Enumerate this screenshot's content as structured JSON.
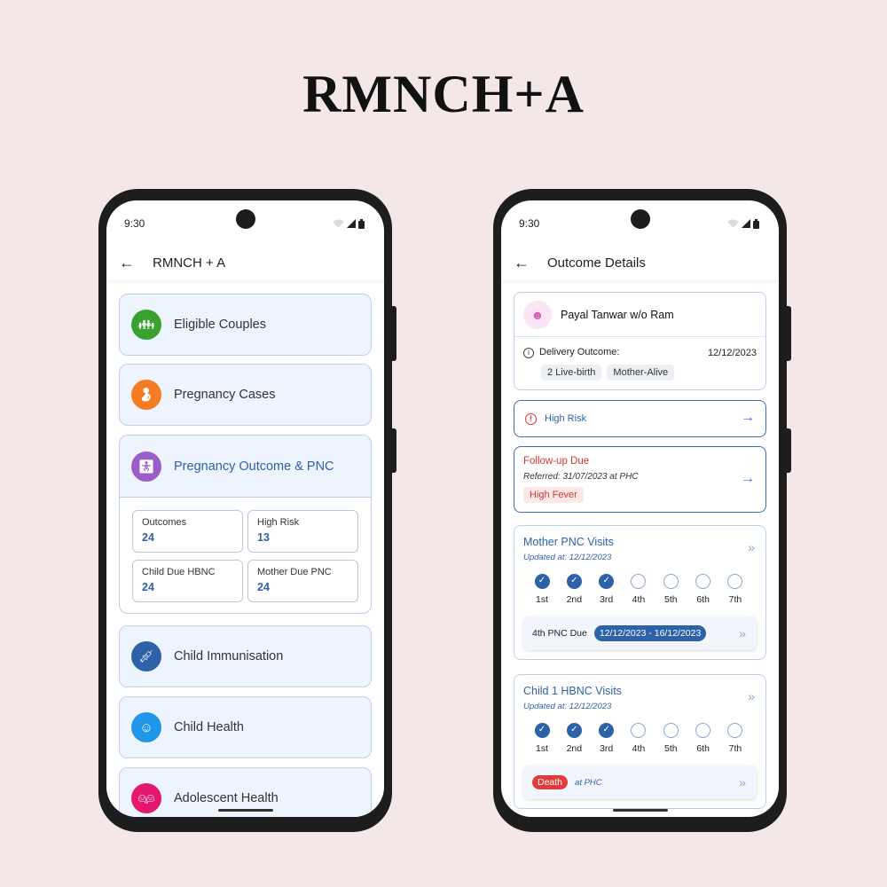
{
  "title": "RMNCH+A",
  "status_time": "9:30",
  "left": {
    "app_title": "RMNCH + A",
    "menu": [
      {
        "label": "Eligible Couples",
        "color": "#3aa12f",
        "icon": "family-icon"
      },
      {
        "label": "Pregnancy Cases",
        "color": "#f57c23",
        "icon": "pregnant-woman-icon"
      },
      {
        "label": "Pregnancy Outcome & PNC",
        "color": "#9b5ec9",
        "icon": "baby-changing-icon"
      },
      {
        "label": "Child Immunisation",
        "color": "#2e62a8",
        "icon": "vaccine-icon"
      },
      {
        "label": "Child Health",
        "color": "#1f96e8",
        "icon": "child-face-icon"
      },
      {
        "label": "Adolescent Health",
        "color": "#e3176e",
        "icon": "adolescents-icon"
      }
    ],
    "stats": [
      {
        "label": "Outcomes",
        "value": "24"
      },
      {
        "label": "High Risk",
        "value": "13"
      },
      {
        "label": "Child Due HBNC",
        "value": "24"
      },
      {
        "label": "Mother Due PNC",
        "value": "24"
      }
    ]
  },
  "right": {
    "app_title": "Outcome Details",
    "patient_name": "Payal Tanwar w/o Ram",
    "delivery_label": "Delivery Outcome:",
    "delivery_date": "12/12/2023",
    "chips": [
      "2 Live-birth",
      "Mother-Alive"
    ],
    "high_risk": "High Risk",
    "followup_title": "Follow-up Due",
    "followup_ref": "Referred: 31/07/2023 at PHC",
    "followup_chip": "High Fever",
    "mother_title": "Mother PNC Visits",
    "mother_updated": "Updated at: 12/12/2023",
    "mother_due_label": "4th PNC Due",
    "mother_due_range": "12/12/2023 - 16/12/2023",
    "child_title": "Child 1 HBNC Visits",
    "child_updated": "Updated at: 12/12/2023",
    "child_death": "Death",
    "child_death_place": "at PHC",
    "steps": [
      "1st",
      "2nd",
      "3rd",
      "4th",
      "5th",
      "6th",
      "7th"
    ],
    "completed_visits": 3
  }
}
